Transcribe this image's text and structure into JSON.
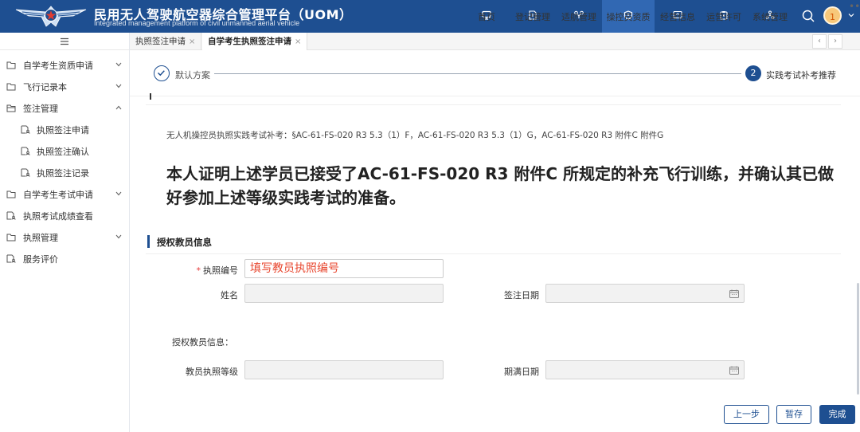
{
  "header": {
    "title": "民用无人驾驶航空器综合管理平台（UOM）",
    "subtitle": "Integrated management platform of civil unmanned aerial vehicle",
    "nav": [
      {
        "label": "首页",
        "icon": "monitor-icon"
      },
      {
        "label": "登记管理",
        "icon": "document-edit-icon"
      },
      {
        "label": "适航管理",
        "icon": "drone-icon"
      },
      {
        "label": "操控员资质",
        "icon": "shield-icon",
        "active": true
      },
      {
        "label": "经营信息",
        "icon": "screen-icon"
      },
      {
        "label": "运营许可",
        "icon": "clipboard-icon"
      },
      {
        "label": "系统管理",
        "icon": "network-icon"
      }
    ],
    "avatar_text": "1",
    "brand_color": "#1e4f91"
  },
  "sidebar": {
    "items": [
      {
        "label": "自学考生资质申请",
        "icon": "folder-icon",
        "chevron": "down"
      },
      {
        "label": "飞行记录本",
        "icon": "folder-icon",
        "chevron": "down"
      },
      {
        "label": "签注管理",
        "icon": "folder-open-icon",
        "chevron": "up"
      },
      {
        "label": "执照签注申请",
        "icon": "doc-user-icon",
        "sub": true
      },
      {
        "label": "执照签注确认",
        "icon": "doc-user-icon",
        "sub": true
      },
      {
        "label": "执照签注记录",
        "icon": "doc-user-icon",
        "sub": true
      },
      {
        "label": "自学考生考试申请",
        "icon": "folder-icon",
        "chevron": "down"
      },
      {
        "label": "执照考试成绩查看",
        "icon": "doc-user-icon"
      },
      {
        "label": "执照管理",
        "icon": "folder-icon",
        "chevron": "down"
      },
      {
        "label": "服务评价",
        "icon": "doc-user-icon"
      }
    ]
  },
  "tabs": [
    {
      "label": "执照签注申请",
      "active": false
    },
    {
      "label": "自学考生执照签注申请",
      "active": true
    }
  ],
  "steps": [
    {
      "label": "默认方案",
      "state": "done"
    },
    {
      "num": "2",
      "label": "实践考试补考推荐",
      "state": "current"
    }
  ],
  "content": {
    "clause": "无人机操控员执照实践考试补考：§AC-61-FS-020 R3 5.3（1）F，AC-61-FS-020 R3 5.3（1）G，AC-61-FS-020 R3 附件C 附件G",
    "statement": "本人证明上述学员已接受了AC-61-FS-020 R3 附件C 所规定的补充飞行训练，并确认其已做好参加上述等级实践考试的准备。"
  },
  "form": {
    "section_title": "授权教员信息",
    "required_mark": "*",
    "license_no_label": "执照编号",
    "license_no_value": "填写教员执照编号",
    "name_label": "姓名",
    "name_value": "",
    "endorse_date_label": "签注日期",
    "endorse_date_value": "",
    "instructor_info_label": "授权教员信息：",
    "license_level_label": "教员执照等级",
    "license_level_value": "",
    "expiry_date_label": "期满日期",
    "expiry_date_value": ""
  },
  "actions": {
    "prev": "上一步",
    "save": "暂存",
    "finish": "完成"
  }
}
